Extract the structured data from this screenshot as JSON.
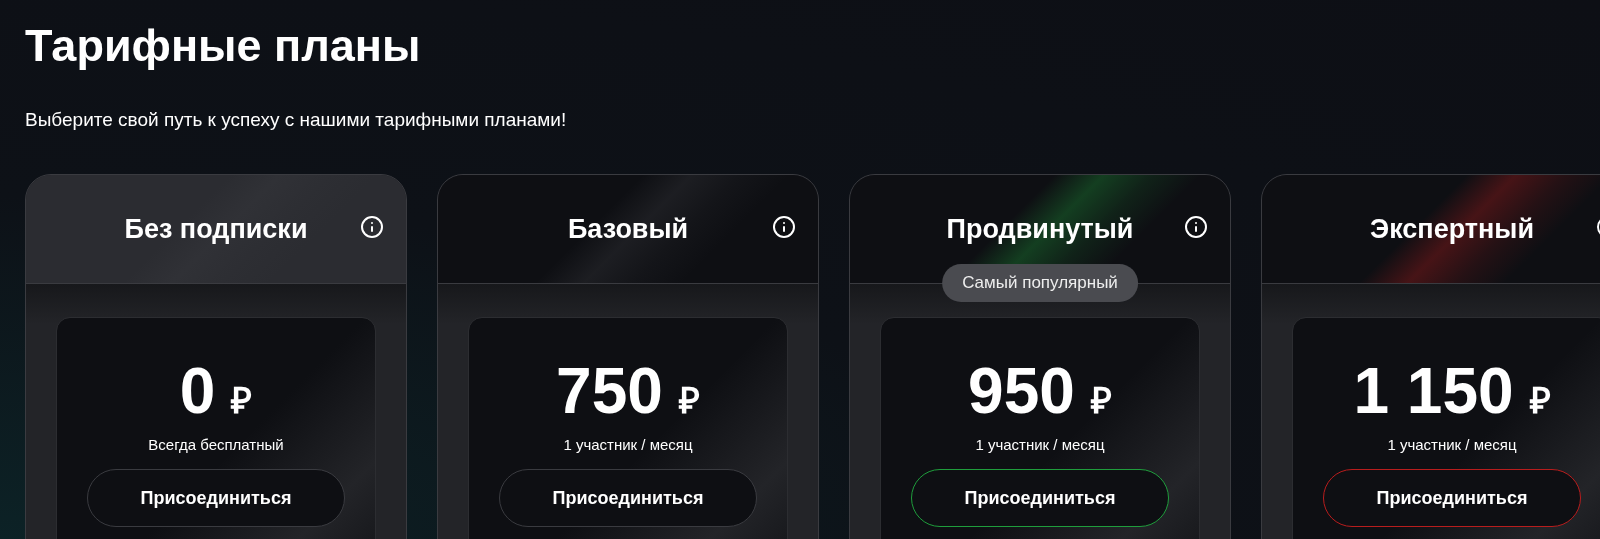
{
  "title": "Тарифные планы",
  "subtitle": "Выберите свой путь к успеху с нашими тарифными планами!",
  "plans": [
    {
      "name": "Без подписки",
      "current": true,
      "color": "#3a3b40",
      "price": "0",
      "currency": "₽",
      "note": "Всегда бесплатный",
      "button": "Присоединиться"
    },
    {
      "name": "Базовый",
      "current": false,
      "color": "#3a3b40",
      "price": "750",
      "currency": "₽",
      "note": "1 участник / месяц",
      "button": "Присоединиться"
    },
    {
      "name": "Продвинутый",
      "current": false,
      "color": "#1f9d3c",
      "badge": "Самый популярный",
      "price": "950",
      "currency": "₽",
      "note": "1 участник / месяц",
      "button": "Присоединиться"
    },
    {
      "name": "Экспертный",
      "current": false,
      "color": "#b81d1d",
      "price": "1 150",
      "currency": "₽",
      "note": "1 участник / месяц",
      "button": "Присоединиться"
    }
  ]
}
